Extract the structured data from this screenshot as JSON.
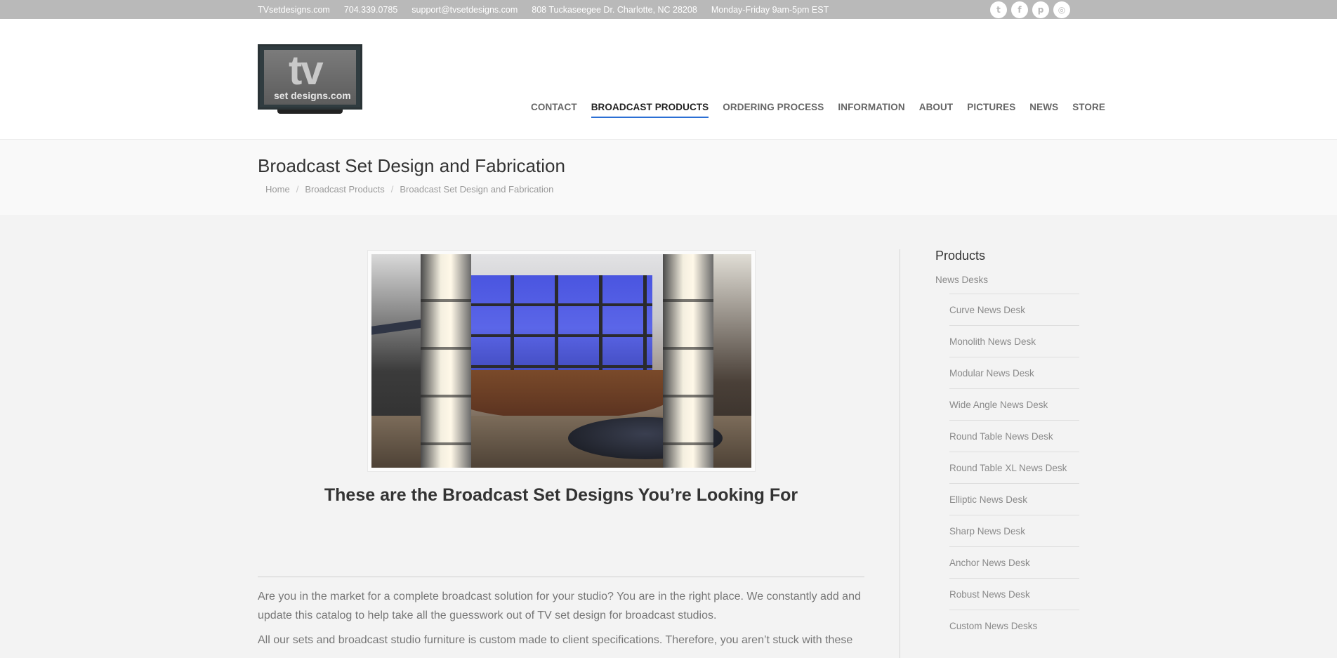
{
  "topbar": {
    "site": "TVsetdesigns.com",
    "phone": "704.339.0785",
    "email": "support@tvsetdesigns.com",
    "address": "808 Tuckaseegee Dr. Charlotte, NC 28208",
    "hours": "Monday-Friday 9am-5pm EST",
    "social": [
      {
        "name": "twitter-icon",
        "glyph": "t"
      },
      {
        "name": "facebook-icon",
        "glyph": "f"
      },
      {
        "name": "pinterest-icon",
        "glyph": "p"
      },
      {
        "name": "instagram-icon",
        "glyph": "◎"
      }
    ]
  },
  "logo": {
    "big": "tv",
    "sub": "set designs.com"
  },
  "nav": [
    {
      "label": "CONTACT",
      "active": false
    },
    {
      "label": "BROADCAST PRODUCTS",
      "active": true
    },
    {
      "label": "ORDERING PROCESS",
      "active": false
    },
    {
      "label": "INFORMATION",
      "active": false
    },
    {
      "label": "ABOUT",
      "active": false
    },
    {
      "label": "PICTURES",
      "active": false
    },
    {
      "label": "NEWS",
      "active": false
    },
    {
      "label": "STORE",
      "active": false
    }
  ],
  "page": {
    "title": "Broadcast Set Design and Fabrication",
    "breadcrumbs": [
      "Home",
      "Broadcast Products",
      "Broadcast Set Design and Fabrication"
    ]
  },
  "main": {
    "tagline": "These are the Broadcast Set Designs You’re Looking For",
    "paragraph1": "Are you in the market for a complete broadcast solution for your studio? You are in the right place. We constantly add and update this catalog to help take all the guesswork out of TV set design for broadcast studios.",
    "paragraph2": "All our sets and broadcast studio furniture is custom made to client specifications. Therefore, you aren’t stuck with these"
  },
  "sidebar": {
    "heading": "Products",
    "category": "News Desks",
    "items": [
      "Curve News Desk",
      "Monolith News Desk",
      "Modular News Desk",
      "Wide Angle News Desk",
      "Round Table News Desk",
      "Round Table XL News Desk",
      "Elliptic News Desk",
      "Sharp News Desk",
      "Anchor News Desk",
      "Robust News Desk",
      "Custom News Desks"
    ]
  },
  "colors": {
    "accent": "#2b6fd4",
    "topbar": "#b9b9b9"
  }
}
